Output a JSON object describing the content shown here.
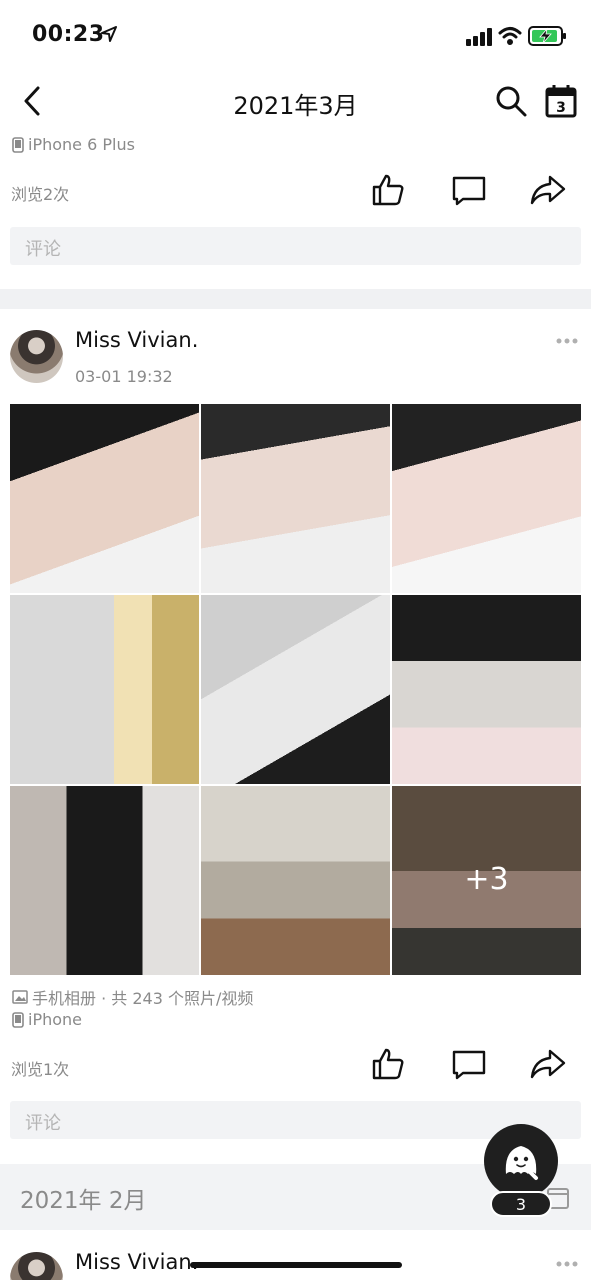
{
  "status_bar": {
    "time": "00:23"
  },
  "nav": {
    "title": "2021年3月",
    "calendar_day": "3"
  },
  "prev_post": {
    "device": "iPhone 6 Plus",
    "views": "浏览2次",
    "comment_placeholder": "评论"
  },
  "post": {
    "author": "Miss Vivian.",
    "time": "03-01 19:32",
    "photos": [
      "photo-1",
      "photo-2",
      "photo-3",
      "photo-4",
      "photo-5",
      "photo-6",
      "photo-7",
      "photo-8",
      "photo-9"
    ],
    "more_photos": "+3",
    "album": "手机相册 · 共 243 个照片/视频",
    "device": "iPhone",
    "views": "浏览1次",
    "comment_placeholder": "评论"
  },
  "month_section": {
    "label": "2021年 2月"
  },
  "next_post": {
    "author": "Miss Vivian."
  },
  "fab": {
    "badge": "3"
  },
  "colors": {
    "background": "#ffffff",
    "divider": "#f0f1f3",
    "muted_text": "#8a8a8a",
    "comment_bg": "#f2f3f5"
  }
}
